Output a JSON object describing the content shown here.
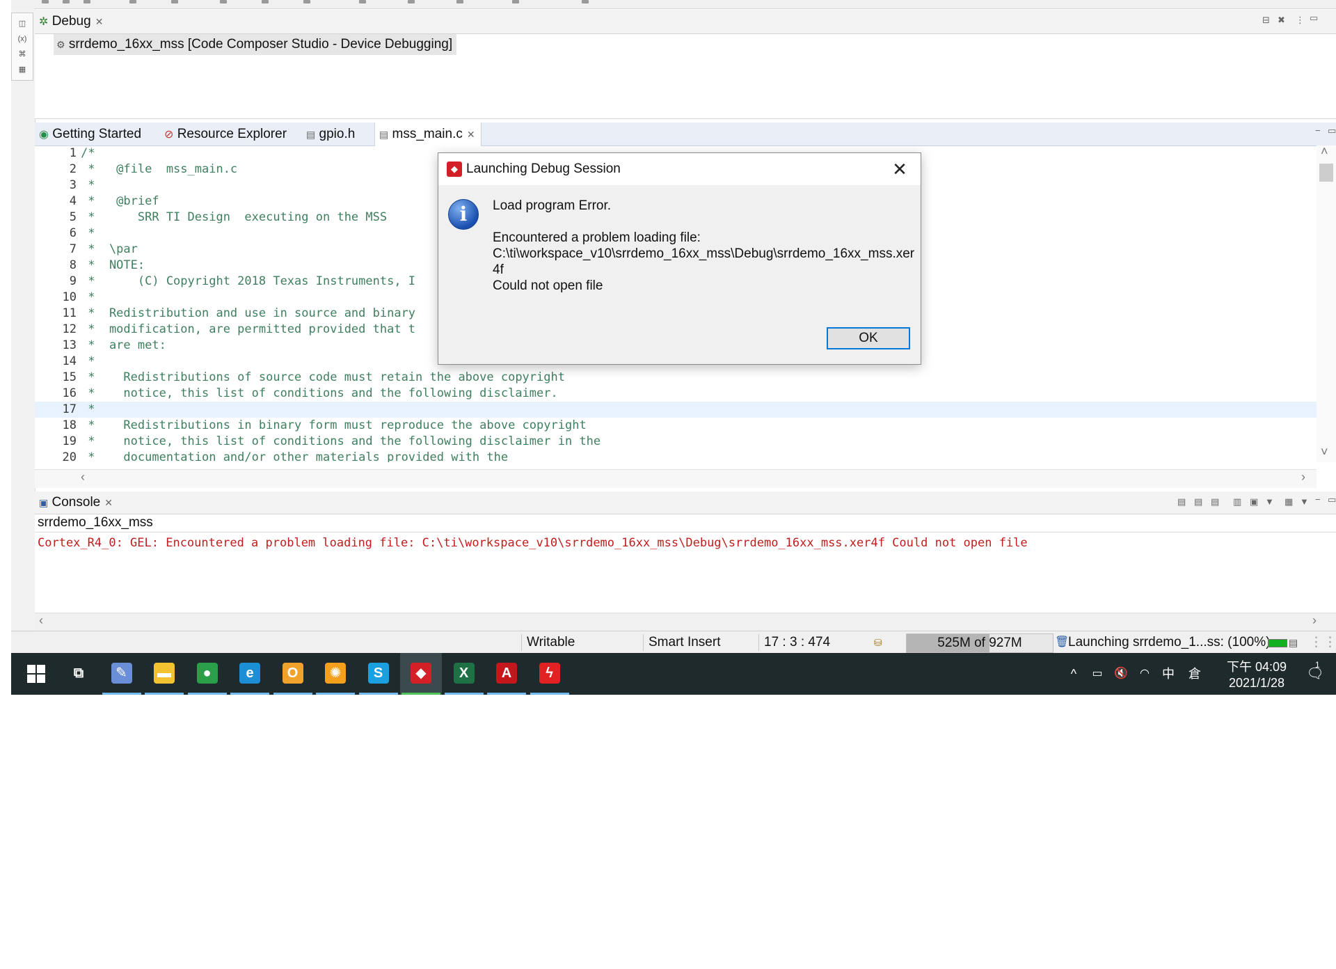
{
  "debug": {
    "tab_label": "Debug",
    "session": "srrdemo_16xx_mss [Code Composer Studio - Device Debugging]"
  },
  "editor": {
    "tabs": [
      {
        "label": "Getting Started",
        "icon": "globe-icon"
      },
      {
        "label": "Resource Explorer",
        "icon": "compass-icon"
      },
      {
        "label": "gpio.h",
        "icon": "header-file-icon"
      },
      {
        "label": "mss_main.c",
        "icon": "c-file-icon",
        "active": true
      }
    ],
    "current_line": 17,
    "lines": [
      {
        "n": "1",
        "text": "/*"
      },
      {
        "n": "2",
        "text": " *   @file  mss_main.c"
      },
      {
        "n": "3",
        "text": " *"
      },
      {
        "n": "4",
        "text": " *   @brief"
      },
      {
        "n": "5",
        "text": " *      SRR TI Design  executing on the MSS"
      },
      {
        "n": "6",
        "text": " *"
      },
      {
        "n": "7",
        "text": " *  \\par"
      },
      {
        "n": "8",
        "text": " *  NOTE:"
      },
      {
        "n": "9",
        "text": " *      (C) Copyright 2018 Texas Instruments, I"
      },
      {
        "n": "10",
        "text": " *"
      },
      {
        "n": "11",
        "text": " *  Redistribution and use in source and binary"
      },
      {
        "n": "12",
        "text": " *  modification, are permitted provided that t"
      },
      {
        "n": "13",
        "text": " *  are met:"
      },
      {
        "n": "14",
        "text": " *"
      },
      {
        "n": "15",
        "text": " *    Redistributions of source code must retain the above copyright"
      },
      {
        "n": "16",
        "text": " *    notice, this list of conditions and the following disclaimer."
      },
      {
        "n": "17",
        "text": " *"
      },
      {
        "n": "18",
        "text": " *    Redistributions in binary form must reproduce the above copyright"
      },
      {
        "n": "19",
        "text": " *    notice, this list of conditions and the following disclaimer in the"
      },
      {
        "n": "20",
        "text": " *    documentation and/or other materials provided with the"
      }
    ]
  },
  "console": {
    "tab_label": "Console",
    "name": "srrdemo_16xx_mss",
    "output": "Cortex_R4_0: GEL: Encountered a problem loading file: C:\\ti\\workspace_v10\\srrdemo_16xx_mss\\Debug\\srrdemo_16xx_mss.xer4f Could not open file",
    "output_color": "#c01e1e"
  },
  "dialog": {
    "title": "Launching Debug Session",
    "heading": "Load program Error.",
    "line1": "Encountered a problem loading file:",
    "line2": "C:\\ti\\workspace_v10\\srrdemo_16xx_mss\\Debug\\srrdemo_16xx_mss.xer",
    "line3": "4f",
    "line4": "Could not open file",
    "ok_label": "OK",
    "close_glyph": "✕",
    "info_glyph": "i"
  },
  "status": {
    "writable": "Writable",
    "insert_mode": "Smart Insert",
    "position": "17 : 3 : 474",
    "heap": "525M of 927M",
    "heap_used_fraction": 0.566,
    "progress": "Launching srrdemo_1...ss: (100%)",
    "progress_fraction": 1.0
  },
  "taskbar": {
    "apps": [
      {
        "name": "task-view",
        "icon": "task-view-icon",
        "color": "transparent"
      },
      {
        "name": "paint",
        "icon": "palette-icon",
        "color": "#6a8fd6"
      },
      {
        "name": "file-explorer",
        "icon": "folder-icon",
        "color": "#f2c230"
      },
      {
        "name": "chrome",
        "icon": "chrome-icon",
        "color": "#2b9e49"
      },
      {
        "name": "edge",
        "icon": "edge-icon",
        "color": "#1c8ed4"
      },
      {
        "name": "outlook",
        "icon": "outlook-icon",
        "color": "#f0a22b"
      },
      {
        "name": "fan-app",
        "icon": "fan-icon",
        "color": "#f4a01c"
      },
      {
        "name": "skype",
        "icon": "skype-icon",
        "color": "#1aa0e0"
      },
      {
        "name": "code-composer-studio",
        "icon": "ccs-cube-icon",
        "color": "#d31f26",
        "active": true
      },
      {
        "name": "excel",
        "icon": "excel-icon",
        "color": "#1e7145"
      },
      {
        "name": "acrobat",
        "icon": "acrobat-icon",
        "color": "#c4171c"
      },
      {
        "name": "flash-app",
        "icon": "lightning-icon",
        "color": "#e22222"
      }
    ],
    "tray": {
      "chevron": "^",
      "ime_mode": "中",
      "ime_layout": "倉",
      "time": "下午 04:09",
      "date": "2021/1/28",
      "notification_count": "1"
    }
  }
}
